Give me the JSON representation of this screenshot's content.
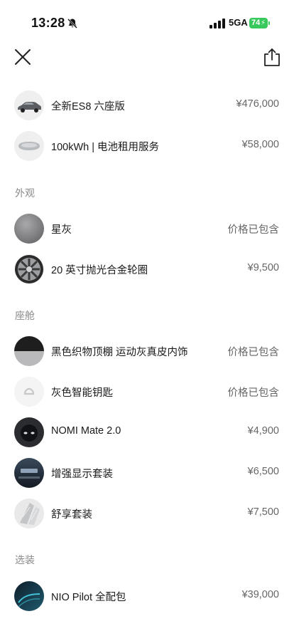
{
  "status": {
    "time": "13:28",
    "network": "5GA",
    "battery": "74"
  },
  "toolbar": {
    "close_icon": "close-icon",
    "share_icon": "share-icon"
  },
  "items": [
    {
      "label": "全新ES8 六座版",
      "price": "¥476,000",
      "icon": "car-thumbnail"
    },
    {
      "label": "100kWh | 电池租用服务",
      "price": "¥58,000",
      "icon": "battery-pack-thumbnail"
    }
  ],
  "sections": [
    {
      "title": "外观",
      "items": [
        {
          "label": "星灰",
          "price": "价格已包含",
          "icon": "paint-swatch"
        },
        {
          "label": "20 英寸抛光合金轮圈",
          "price": "¥9,500",
          "icon": "wheel-thumbnail"
        }
      ]
    },
    {
      "title": "座舱",
      "items": [
        {
          "label": "黑色织物顶棚 运动灰真皮内饰",
          "price": "价格已包含",
          "icon": "interior-swatch"
        },
        {
          "label": "灰色智能钥匙",
          "price": "价格已包含",
          "icon": "smart-key-thumbnail"
        },
        {
          "label": "NOMI Mate 2.0",
          "price": "¥4,900",
          "icon": "nomi-thumbnail"
        },
        {
          "label": "增强显示套装",
          "price": "¥6,500",
          "icon": "display-thumbnail"
        },
        {
          "label": "舒享套装",
          "price": "¥7,500",
          "icon": "seat-thumbnail"
        }
      ]
    },
    {
      "title": "选装",
      "items": [
        {
          "label": "NIO Pilot 全配包",
          "price": "¥39,000",
          "icon": "pilot-thumbnail"
        }
      ]
    }
  ]
}
